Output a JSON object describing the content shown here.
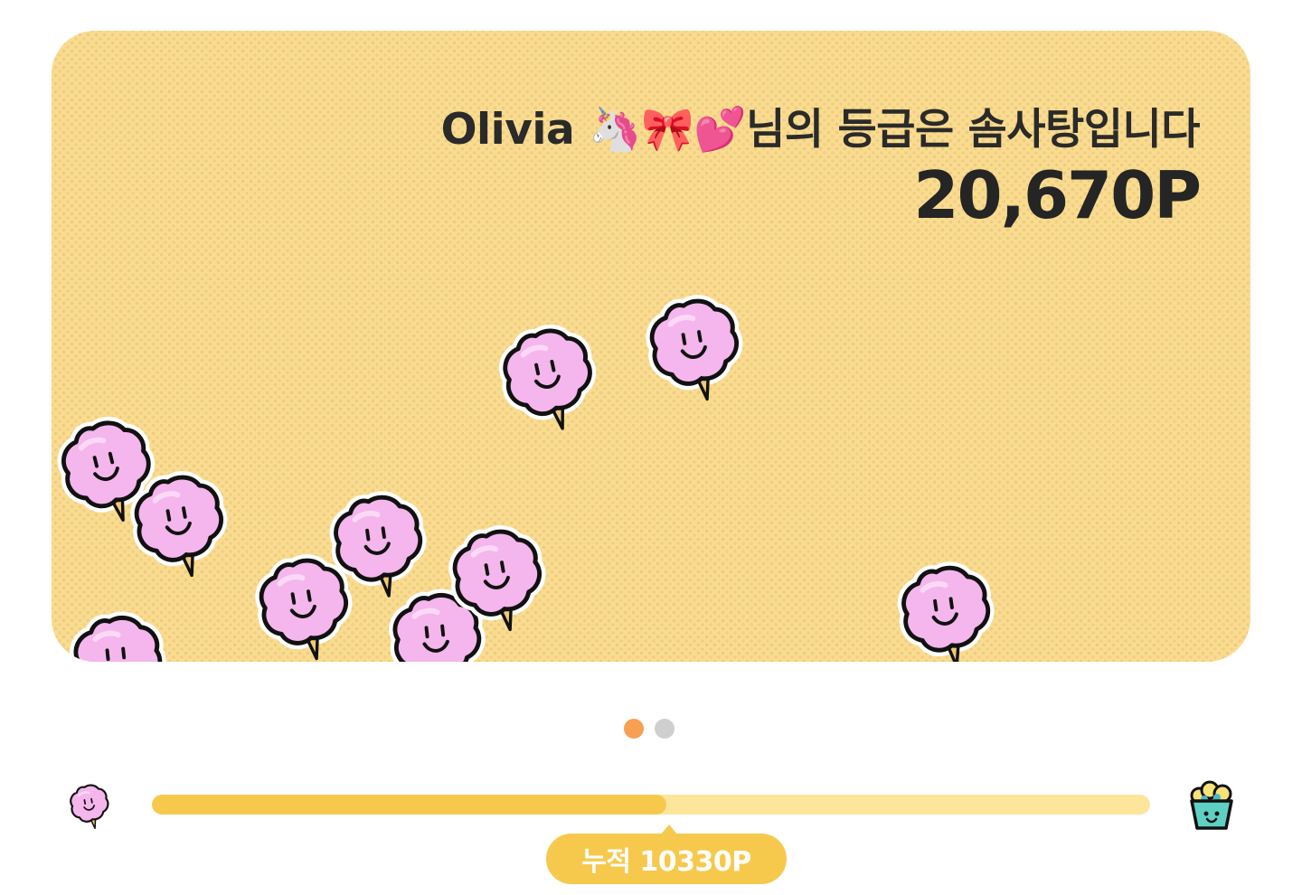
{
  "grade_card": {
    "title": "Olivia 🦄🎀💕님의 등급은 솜사탕입니다",
    "points": "20,670P",
    "background_color": "#f9dc91",
    "decoration_icon": "cotton-candy-icon"
  },
  "carousel": {
    "page_count": 2,
    "active_index": 0,
    "active_color": "#f7a052",
    "inactive_color": "#cfcfcf"
  },
  "progress": {
    "fill_percent": 51.5,
    "fill_color": "#f6c94d",
    "track_color": "#fde59c",
    "start_level_icon": "cotton-candy-icon",
    "end_level_icon": "popcorn-bucket-icon",
    "cumulative_label": "누적 10330P"
  }
}
